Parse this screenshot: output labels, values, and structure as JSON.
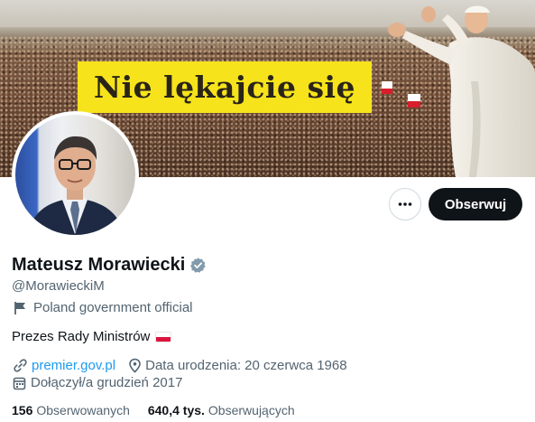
{
  "banner": {
    "slogan": "Nie lękajcie się",
    "slogan_bg": "#f6e31b"
  },
  "actions": {
    "more_icon": "more-horizontal-icon",
    "more_label": "•••",
    "follow_label": "Obserwuj"
  },
  "profile": {
    "name": "Mateusz Morawiecki",
    "verified_icon": "verified-badge-icon",
    "handle": "@MorawieckiM",
    "label_icon": "flag-icon",
    "label": "Poland government official",
    "bio": "Prezes Rady Ministrów",
    "bio_emoji": "poland-flag-emoji"
  },
  "details": {
    "website_icon": "link-icon",
    "website": "premier.gov.pl",
    "birth_icon": "location-pin-icon",
    "birth": "Data urodzenia: 20 czerwca 1968",
    "joined_icon": "calendar-icon",
    "joined": "Dołączył/a grudzień 2017"
  },
  "stats": {
    "following_count": "156",
    "following_label": "Obserwowanych",
    "followers_count": "640,4 tys.",
    "followers_label": "Obserwujących"
  },
  "colors": {
    "accent": "#1d9bf0",
    "text_primary": "#0f1419",
    "text_secondary": "#536471",
    "follow_bg": "#0f1419"
  }
}
